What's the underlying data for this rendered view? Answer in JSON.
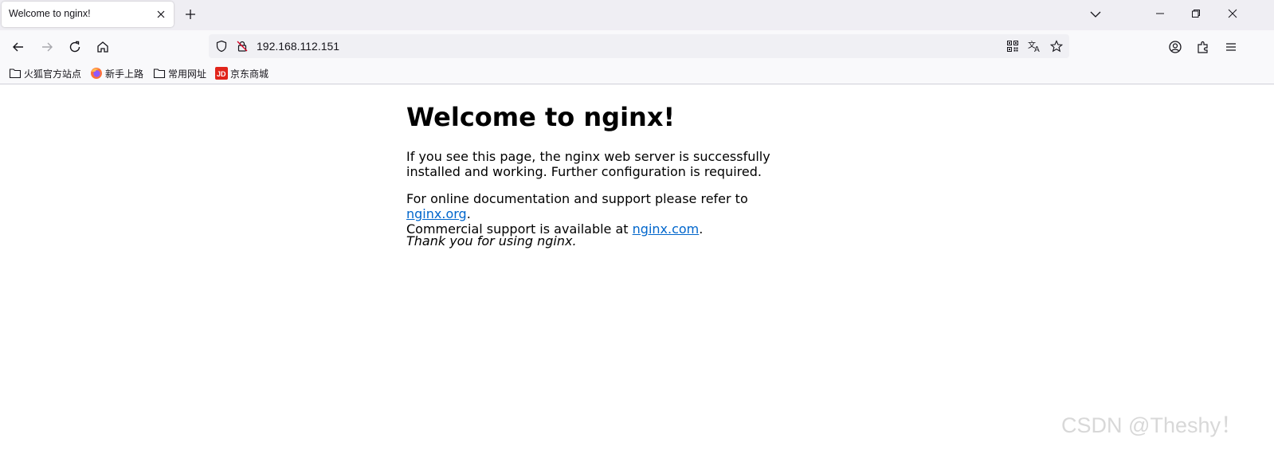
{
  "window": {
    "tab_title": "Welcome to nginx!"
  },
  "navbar": {
    "url": "192.168.112.151"
  },
  "bookmarks": [
    {
      "label": "火狐官方站点",
      "icon": "folder-icon"
    },
    {
      "label": "新手上路",
      "icon": "firefox-icon"
    },
    {
      "label": "常用网址",
      "icon": "folder-icon"
    },
    {
      "label": "京东商城",
      "icon": "jd-icon"
    }
  ],
  "page": {
    "heading": "Welcome to nginx!",
    "para1": "If you see this page, the nginx web server is successfully installed and working. Further configuration is required.",
    "para2_prefix": "For online documentation and support please refer to ",
    "link1": "nginx.org",
    "para2_mid": ".",
    "para2_line2": "Commercial support is available at ",
    "link2": "nginx.com",
    "para2_suffix": ".",
    "thanks": "Thank you for using nginx."
  },
  "watermark": "CSDN @Theshy！",
  "colors": {
    "link": "#0066cc",
    "jd_red": "#e1251b",
    "chrome_bg": "#efeef3"
  }
}
